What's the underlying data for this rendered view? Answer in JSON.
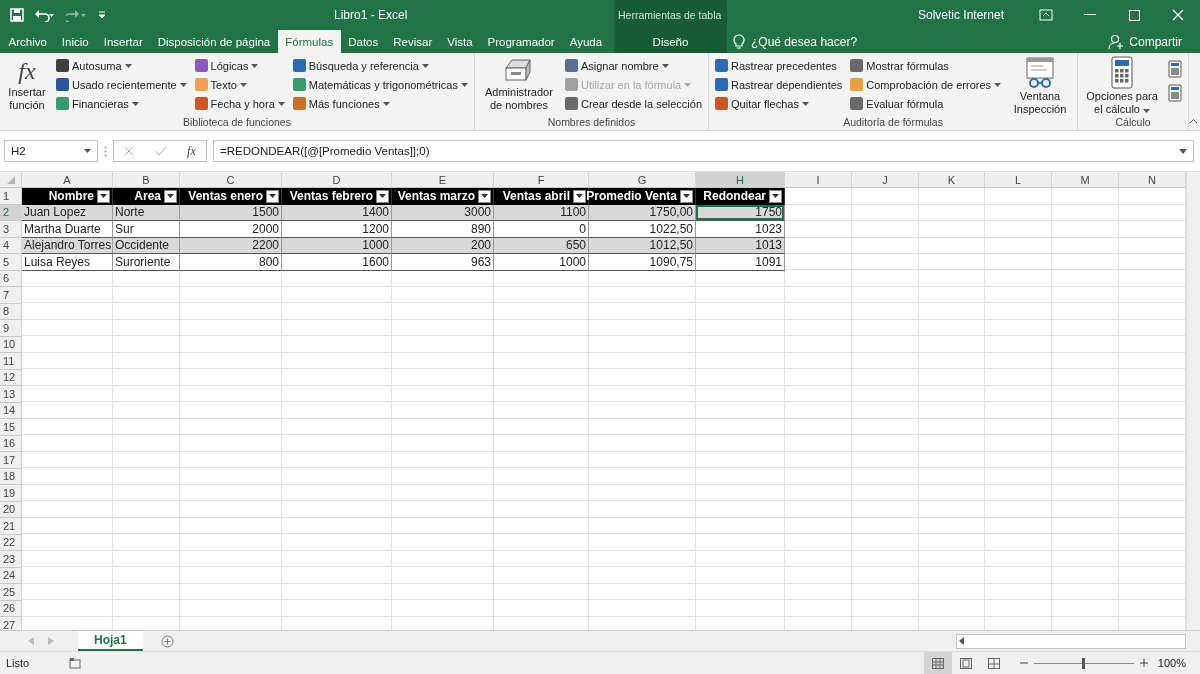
{
  "title_bar": {
    "title": "Libro1 - Excel",
    "context_label": "Herramientas de tabla",
    "user": "Solvetic Internet"
  },
  "tabs": [
    {
      "label": "Archivo",
      "selected": false
    },
    {
      "label": "Inicio",
      "selected": false
    },
    {
      "label": "Insertar",
      "selected": false
    },
    {
      "label": "Disposición de página",
      "selected": false
    },
    {
      "label": "Fórmulas",
      "selected": true
    },
    {
      "label": "Datos",
      "selected": false
    },
    {
      "label": "Revisar",
      "selected": false
    },
    {
      "label": "Vista",
      "selected": false
    },
    {
      "label": "Programador",
      "selected": false
    },
    {
      "label": "Ayuda",
      "selected": false
    }
  ],
  "context_tab": {
    "label": "Diseño",
    "selected": false
  },
  "tell_me": {
    "placeholder": "¿Qué desea hacer?"
  },
  "share": "Compartir",
  "ribbon": [
    {
      "label": "Biblioteca de funciones",
      "items": [
        {
          "kind": "large",
          "label": "Insertar función",
          "icon_text": "fx",
          "dropdown": false
        },
        {
          "kind": "column",
          "entries": [
            {
              "label": "Autosuma",
              "color": "#404040",
              "dropdown": true,
              "disabled": false
            },
            {
              "label": "Usado recientemente",
              "color": "#2b579a",
              "dropdown": true,
              "disabled": false
            },
            {
              "label": "Financieras",
              "color": "#3a9a6a",
              "dropdown": true,
              "disabled": false
            }
          ]
        },
        {
          "kind": "column",
          "entries": [
            {
              "label": "Lógicas",
              "color": "#8a5ab8",
              "dropdown": true,
              "disabled": false
            },
            {
              "label": "Texto",
              "color": "#f0a050",
              "dropdown": true,
              "disabled": false
            },
            {
              "label": "Fecha y hora",
              "color": "#c8582a",
              "dropdown": true,
              "disabled": false
            }
          ]
        },
        {
          "kind": "column",
          "entries": [
            {
              "label": "Búsqueda y referencia",
              "color": "#2b6cb0",
              "dropdown": true,
              "disabled": false
            },
            {
              "label": "Matemáticas y trigonométricas",
              "color": "#3a9a6a",
              "dropdown": true,
              "disabled": false
            },
            {
              "label": "Más funciones",
              "color": "#c8702a",
              "dropdown": true,
              "disabled": false
            }
          ]
        }
      ]
    },
    {
      "label": "Nombres definidos",
      "items": [
        {
          "kind": "large",
          "label": "Administrador de nombres",
          "dropdown": false
        },
        {
          "kind": "column",
          "entries": [
            {
              "label": "Asignar nombre",
              "color": "#5a6f8a",
              "dropdown": true,
              "disabled": false
            },
            {
              "label": "Utilizar en la fórmula",
              "color": "#a0a0a0",
              "dropdown": true,
              "disabled": true
            },
            {
              "label": "Crear desde la selección",
              "color": "#6a6a6a",
              "dropdown": false,
              "disabled": false
            }
          ]
        }
      ]
    },
    {
      "label": "Auditoría de fórmulas",
      "items": [
        {
          "kind": "column",
          "entries": [
            {
              "label": "Rastrear precedentes",
              "color": "#2b6cb0",
              "dropdown": false,
              "disabled": false
            },
            {
              "label": "Rastrear dependientes",
              "color": "#2b6cb0",
              "dropdown": false,
              "disabled": false
            },
            {
              "label": "Quitar flechas",
              "color": "#c8582a",
              "dropdown": true,
              "disabled": false
            }
          ]
        },
        {
          "kind": "column",
          "entries": [
            {
              "label": "Mostrar fórmulas",
              "color": "#6a6a6a",
              "dropdown": false,
              "disabled": false
            },
            {
              "label": "Comprobación de errores",
              "color": "#e8a040",
              "dropdown": true,
              "disabled": false
            },
            {
              "label": "Evaluar fórmula",
              "color": "#6a6a6a",
              "dropdown": false,
              "disabled": false
            }
          ]
        },
        {
          "kind": "large",
          "label": "Ventana Inspección",
          "dropdown": false
        }
      ]
    },
    {
      "label": "Cálculo",
      "items": [
        {
          "kind": "large",
          "label": "Opciones para el cálculo",
          "dropdown": true
        },
        {
          "kind": "icons"
        }
      ]
    }
  ],
  "formula_bar": {
    "name_box": "H2",
    "fx": "fx",
    "formula": "=REDONDEAR([@[Promedio Ventas]];0)"
  },
  "column_letters": [
    {
      "label": "A",
      "selected": false
    },
    {
      "label": "B",
      "selected": false
    },
    {
      "label": "C",
      "selected": false
    },
    {
      "label": "D",
      "selected": false
    },
    {
      "label": "E",
      "selected": false
    },
    {
      "label": "F",
      "selected": false
    },
    {
      "label": "G",
      "selected": false
    },
    {
      "label": "H",
      "selected": true
    },
    {
      "label": "I",
      "selected": false
    },
    {
      "label": "J",
      "selected": false
    },
    {
      "label": "K",
      "selected": false
    },
    {
      "label": "L",
      "selected": false
    },
    {
      "label": "M",
      "selected": false
    },
    {
      "label": "N",
      "selected": false
    }
  ],
  "row_numbers": [
    {
      "label": "1",
      "selected": false
    },
    {
      "label": "2",
      "selected": true
    },
    {
      "label": "3",
      "selected": false
    },
    {
      "label": "4",
      "selected": false
    },
    {
      "label": "5",
      "selected": false
    },
    {
      "label": "6",
      "selected": false
    },
    {
      "label": "7",
      "selected": false
    },
    {
      "label": "8",
      "selected": false
    },
    {
      "label": "9",
      "selected": false
    },
    {
      "label": "10",
      "selected": false
    },
    {
      "label": "11",
      "selected": false
    },
    {
      "label": "12",
      "selected": false
    },
    {
      "label": "13",
      "selected": false
    },
    {
      "label": "14",
      "selected": false
    },
    {
      "label": "15",
      "selected": false
    },
    {
      "label": "16",
      "selected": false
    },
    {
      "label": "17",
      "selected": false
    },
    {
      "label": "18",
      "selected": false
    },
    {
      "label": "19",
      "selected": false
    },
    {
      "label": "20",
      "selected": false
    },
    {
      "label": "21",
      "selected": false
    },
    {
      "label": "22",
      "selected": false
    },
    {
      "label": "23",
      "selected": false
    },
    {
      "label": "24",
      "selected": false
    },
    {
      "label": "25",
      "selected": false
    },
    {
      "label": "26",
      "selected": false
    },
    {
      "label": "27",
      "selected": false
    }
  ],
  "table": {
    "columns": [
      {
        "label": "Nombre",
        "kind": "text"
      },
      {
        "label": "Area",
        "kind": "text"
      },
      {
        "label": "Ventas enero",
        "kind": "number"
      },
      {
        "label": "Ventas febrero",
        "kind": "number"
      },
      {
        "label": "Ventas marzo",
        "kind": "number"
      },
      {
        "label": "Ventas abril",
        "kind": "number"
      },
      {
        "label": "Promedio Venta",
        "kind": "number"
      },
      {
        "label": "Redondear",
        "kind": "number"
      }
    ],
    "rows": [
      [
        "Juan Lopez",
        "Norte",
        "1500",
        "1400",
        "3000",
        "1100",
        "1750,00",
        "1750"
      ],
      [
        "Martha Duarte",
        "Sur",
        "2000",
        "1200",
        "890",
        "0",
        "1022,50",
        "1023"
      ],
      [
        "Alejandro Torres",
        "Occidente",
        "2200",
        "1000",
        "200",
        "650",
        "1012,50",
        "1013"
      ],
      [
        "Luisa Reyes",
        "Suroriente",
        "800",
        "1600",
        "963",
        "1000",
        "1090,75",
        "1091"
      ]
    ]
  },
  "sheet_tabs": [
    {
      "label": "Hoja1",
      "selected": true
    }
  ],
  "status_bar": {
    "status": "Listo",
    "zoom": "100%",
    "zoom_slider": {
      "level": 0.5
    },
    "views": [
      {
        "selected": true
      },
      {
        "selected": false
      },
      {
        "selected": false
      }
    ]
  }
}
